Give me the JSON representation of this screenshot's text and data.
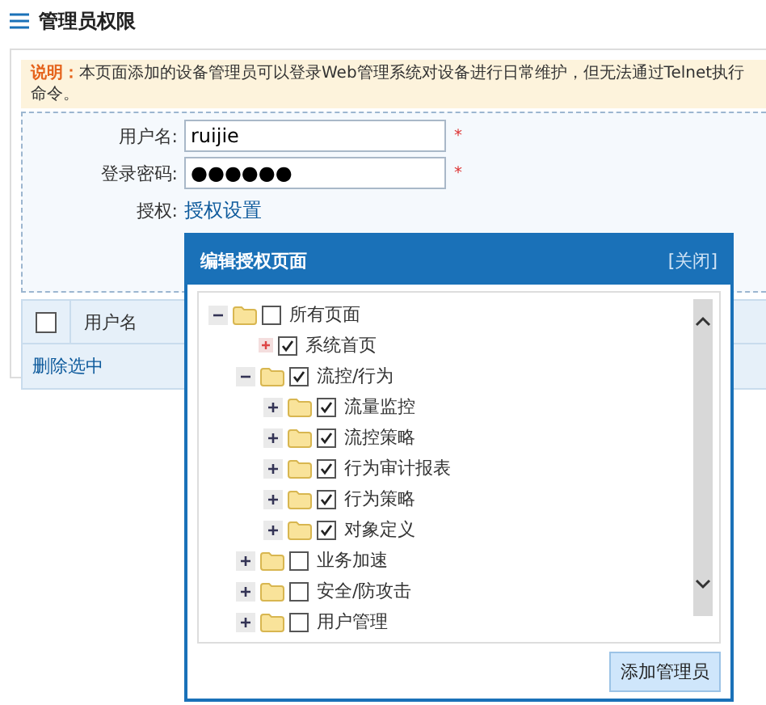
{
  "page_title": "管理员权限",
  "notice": {
    "label": "说明：",
    "text": "本页面添加的设备管理员可以登录Web管理系统对设备进行日常维护，但无法通过Telnet执行命令。"
  },
  "form": {
    "fields": [
      {
        "label": "用户名:",
        "value": "ruijie",
        "required_mark": "*"
      },
      {
        "label": "登录密码:",
        "value": "●●●●●●",
        "required_mark": "*"
      }
    ],
    "auth": {
      "label": "授权:",
      "link": "授权设置"
    }
  },
  "table": {
    "select_all_checked": false,
    "columns": [
      "用户名"
    ],
    "delete_link": "删除选中"
  },
  "dialog": {
    "title": "编辑授权页面",
    "close": "[关闭]",
    "button": "添加管理员",
    "tree": [
      {
        "label": "所有页面",
        "kind": "folder",
        "expanded": true,
        "checked": false,
        "children": [
          {
            "label": "系统首页",
            "kind": "page",
            "checked": true
          },
          {
            "label": "流控/行为",
            "kind": "folder",
            "expanded": true,
            "checked": true,
            "children": [
              {
                "label": "流量监控",
                "kind": "folder",
                "expanded": false,
                "checked": true
              },
              {
                "label": "流控策略",
                "kind": "folder",
                "expanded": false,
                "checked": true
              },
              {
                "label": "行为审计报表",
                "kind": "folder",
                "expanded": false,
                "checked": true
              },
              {
                "label": "行为策略",
                "kind": "folder",
                "expanded": false,
                "checked": true
              },
              {
                "label": "对象定义",
                "kind": "folder",
                "expanded": false,
                "checked": true
              }
            ]
          },
          {
            "label": "业务加速",
            "kind": "folder",
            "expanded": false,
            "checked": false
          },
          {
            "label": "安全/防攻击",
            "kind": "folder",
            "expanded": false,
            "checked": false
          },
          {
            "label": "用户管理",
            "kind": "folder",
            "expanded": false,
            "checked": false
          }
        ]
      }
    ]
  }
}
